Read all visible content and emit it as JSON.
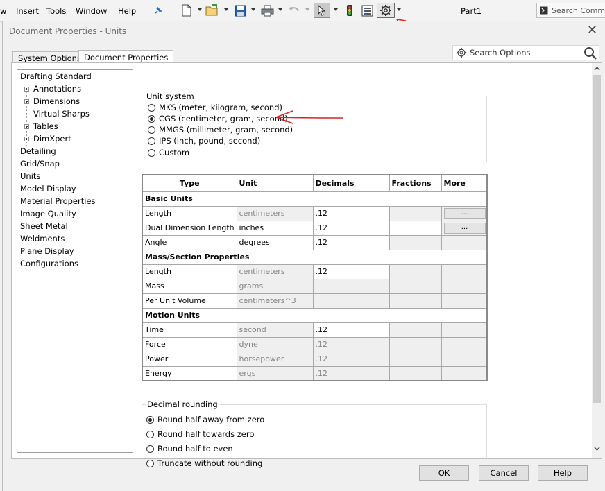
{
  "menubar": {
    "items": [
      "w",
      "Insert",
      "Tools",
      "Window",
      "Help"
    ],
    "part_title": "Part1",
    "search_placeholder": "Search Comma"
  },
  "dialog": {
    "title": "Document Properties - Units",
    "close_glyph": "✕",
    "search_placeholder": "Search Options",
    "tabs": [
      {
        "label": "System Options",
        "active": false
      },
      {
        "label": "Document Properties",
        "active": true
      }
    ],
    "tree": [
      {
        "label": "Drafting Standard",
        "indent": 0,
        "expandable": false
      },
      {
        "label": "Annotations",
        "indent": 1,
        "expandable": true
      },
      {
        "label": "Dimensions",
        "indent": 1,
        "expandable": true
      },
      {
        "label": "Virtual Sharps",
        "indent": 1,
        "expandable": false
      },
      {
        "label": "Tables",
        "indent": 1,
        "expandable": true
      },
      {
        "label": "DimXpert",
        "indent": 1,
        "expandable": true
      },
      {
        "label": "Detailing",
        "indent": 0,
        "expandable": false
      },
      {
        "label": "Grid/Snap",
        "indent": 0,
        "expandable": false
      },
      {
        "label": "Units",
        "indent": 0,
        "expandable": false,
        "selected": true
      },
      {
        "label": "Model Display",
        "indent": 0,
        "expandable": false
      },
      {
        "label": "Material Properties",
        "indent": 0,
        "expandable": false
      },
      {
        "label": "Image Quality",
        "indent": 0,
        "expandable": false
      },
      {
        "label": "Sheet Metal",
        "indent": 0,
        "expandable": false
      },
      {
        "label": "Weldments",
        "indent": 0,
        "expandable": false
      },
      {
        "label": "Plane Display",
        "indent": 0,
        "expandable": false
      },
      {
        "label": "Configurations",
        "indent": 0,
        "expandable": false
      }
    ],
    "unit_system": {
      "label": "Unit system",
      "options": [
        {
          "label": "MKS  (meter, kilogram, second)",
          "checked": false
        },
        {
          "label": "CGS  (centimeter, gram, second)",
          "checked": true
        },
        {
          "label": "MMGS (millimeter, gram, second)",
          "checked": false
        },
        {
          "label": "IPS  (inch, pound, second)",
          "checked": false
        },
        {
          "label": "Custom",
          "checked": false
        }
      ]
    },
    "units_table": {
      "headers": [
        "Type",
        "Unit",
        "Decimals",
        "Fractions",
        "More"
      ],
      "more_glyph": "...",
      "sections": [
        {
          "title": "Basic Units",
          "rows": [
            {
              "type": "Length",
              "unit": "centimeters",
              "unit_enabled": false,
              "decimals": ".12",
              "decimals_enabled": true,
              "fractions_enabled": false,
              "more": true
            },
            {
              "type": "Dual Dimension Length",
              "unit": "inches",
              "unit_enabled": true,
              "decimals": ".12",
              "decimals_enabled": true,
              "fractions_enabled": true,
              "more": true
            },
            {
              "type": "Angle",
              "unit": "degrees",
              "unit_enabled": true,
              "decimals": ".12",
              "decimals_enabled": true,
              "fractions_enabled": false,
              "more": false
            }
          ]
        },
        {
          "title": "Mass/Section Properties",
          "rows": [
            {
              "type": "Length",
              "unit": "centimeters",
              "unit_enabled": false,
              "decimals": ".12",
              "decimals_enabled": true,
              "fractions_enabled": false,
              "more": false
            },
            {
              "type": "Mass",
              "unit": "grams",
              "unit_enabled": false,
              "decimals": "",
              "decimals_enabled": false,
              "fractions_enabled": false,
              "more": false
            },
            {
              "type": "Per Unit Volume",
              "unit": "centimeters^3",
              "unit_enabled": false,
              "decimals": "",
              "decimals_enabled": false,
              "fractions_enabled": false,
              "more": false
            }
          ]
        },
        {
          "title": "Motion Units",
          "rows": [
            {
              "type": "Time",
              "unit": "second",
              "unit_enabled": false,
              "decimals": ".12",
              "decimals_enabled": true,
              "fractions_enabled": false,
              "more": false
            },
            {
              "type": "Force",
              "unit": "dyne",
              "unit_enabled": false,
              "decimals": ".12",
              "decimals_enabled": false,
              "fractions_enabled": false,
              "more": false
            },
            {
              "type": "Power",
              "unit": "horsepower",
              "unit_enabled": false,
              "decimals": ".12",
              "decimals_enabled": false,
              "fractions_enabled": false,
              "more": false
            },
            {
              "type": "Energy",
              "unit": "ergs",
              "unit_enabled": false,
              "decimals": ".12",
              "decimals_enabled": false,
              "fractions_enabled": false,
              "more": false
            }
          ]
        }
      ]
    },
    "decimal_rounding": {
      "label": "Decimal rounding",
      "options": [
        {
          "label": "Round half away from zero",
          "checked": true
        },
        {
          "label": "Round half towards zero",
          "checked": false
        },
        {
          "label": "Round half to even",
          "checked": false
        },
        {
          "label": "Truncate without rounding",
          "checked": false
        }
      ]
    },
    "buttons": {
      "ok": "OK",
      "cancel": "Cancel",
      "help": "Help"
    }
  },
  "colors": {
    "annotation_arrow": "#e02020",
    "selection": "#0078d7"
  }
}
